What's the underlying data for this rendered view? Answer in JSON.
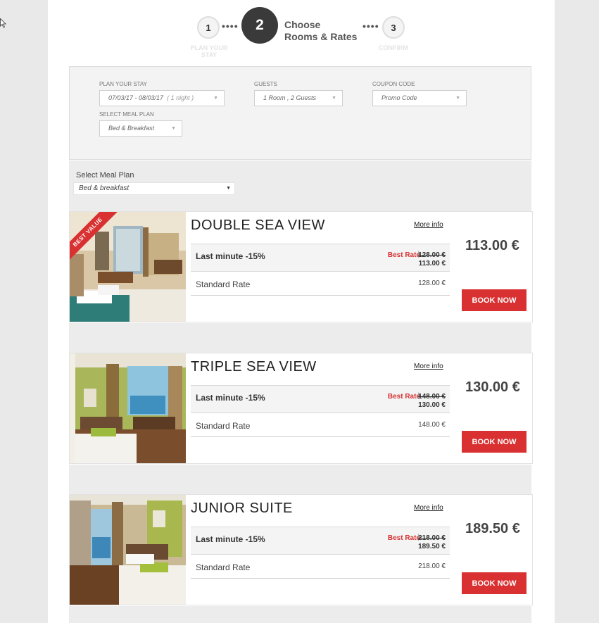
{
  "steps": [
    {
      "number": "1",
      "label_line1": "PLAN YOUR",
      "label_line2": "STAY"
    },
    {
      "number": "2",
      "title_line1": "Choose",
      "title_line2": "Rooms & Rates"
    },
    {
      "number": "3",
      "label": "CONFIRM"
    }
  ],
  "search": {
    "plan_label": "PLAN YOUR STAY",
    "dates_value": "07/03/17 - 08/03/17",
    "nights_value": "( 1 night )",
    "guests_label": "GUESTS",
    "guests_value": "1 Room , 2 Guests",
    "coupon_label": "COUPON CODE",
    "coupon_placeholder": "Promo Code",
    "meal_label": "SELECT MEAL PLAN",
    "meal_value": "Bed & Breakfast"
  },
  "filter": {
    "meal_label": "Select Meal Plan",
    "meal_value": "Bed & breakfast"
  },
  "rooms": [
    {
      "name": "DOUBLE SEA VIEW",
      "more_info": "More info",
      "offer_name": "Last minute -15%",
      "best_rate": "Best Rate",
      "old_price": "128.00 €",
      "new_price": "113.00 €",
      "std_name": "Standard Rate",
      "std_price": "128.00 €",
      "price": "113.00 €",
      "book": "BOOK NOW",
      "ribbon": "BEST VALUE"
    },
    {
      "name": "TRIPLE SEA VIEW",
      "more_info": "More info",
      "offer_name": "Last minute -15%",
      "best_rate": "Best Rate",
      "old_price": "148.00 €",
      "new_price": "130.00 €",
      "std_name": "Standard Rate",
      "std_price": "148.00 €",
      "price": "130.00 €",
      "book": "BOOK NOW"
    },
    {
      "name": "JUNIOR SUITE",
      "more_info": "More info",
      "offer_name": "Last minute -15%",
      "best_rate": "Best Rate",
      "old_price": "218.00 €",
      "new_price": "189.50 €",
      "std_name": "Standard Rate",
      "std_price": "218.00 €",
      "price": "189.50 €",
      "book": "BOOK NOW"
    }
  ],
  "icons": {
    "cursor": "mouse-pointer-icon",
    "dropdown": "caret-down-icon"
  },
  "colors": {
    "accent": "#d93031",
    "step_active": "#3a3a3a"
  }
}
